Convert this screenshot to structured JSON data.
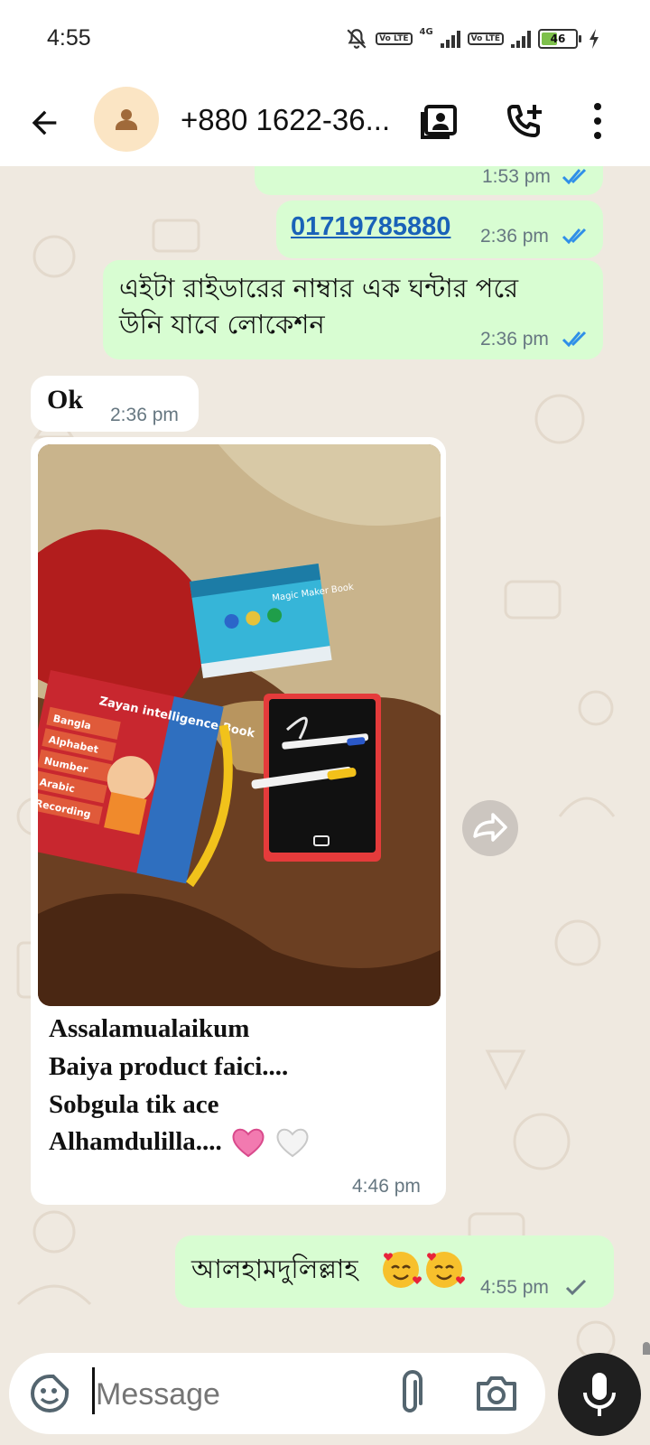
{
  "status_bar": {
    "time": "4:55",
    "network": "4G",
    "lte_label": "Vo LTE",
    "battery": "46"
  },
  "header": {
    "contact": "+880 1622-36..."
  },
  "messages": [
    {
      "time": "1:53 pm"
    },
    {
      "text": "01719785880",
      "time": "2:36 pm"
    },
    {
      "text_line1": "এইটা রাইডারের নাম্বার এক ঘন্টার পরে",
      "text_line2": "উনি যাবে লোকেশন",
      "time": "2:36 pm"
    },
    {
      "text": "Ok",
      "time": "2:36 pm"
    },
    {
      "caption_lines": [
        "Assalamualaikum",
        "Baiya product faici....",
        "Sobgula tik ace",
        "Alhamdulilla...."
      ],
      "time": "4:46 pm"
    },
    {
      "text": "আলহামদুলিল্লাহ",
      "time": "4:55 pm"
    }
  ],
  "photo": {
    "book1_title": "Zayan intelligence Book",
    "book1_items": [
      "Bangla",
      "Alphabet",
      "Number",
      "Arabic",
      "Recording"
    ],
    "book2_title": "Magic Maker Book"
  },
  "composer": {
    "placeholder": "Message"
  },
  "colors": {
    "outgoing_bubble": "#d8fdd2",
    "incoming_bubble": "#ffffff",
    "read_tick": "#2f8fe8",
    "wallpaper": "#efe9e0"
  }
}
